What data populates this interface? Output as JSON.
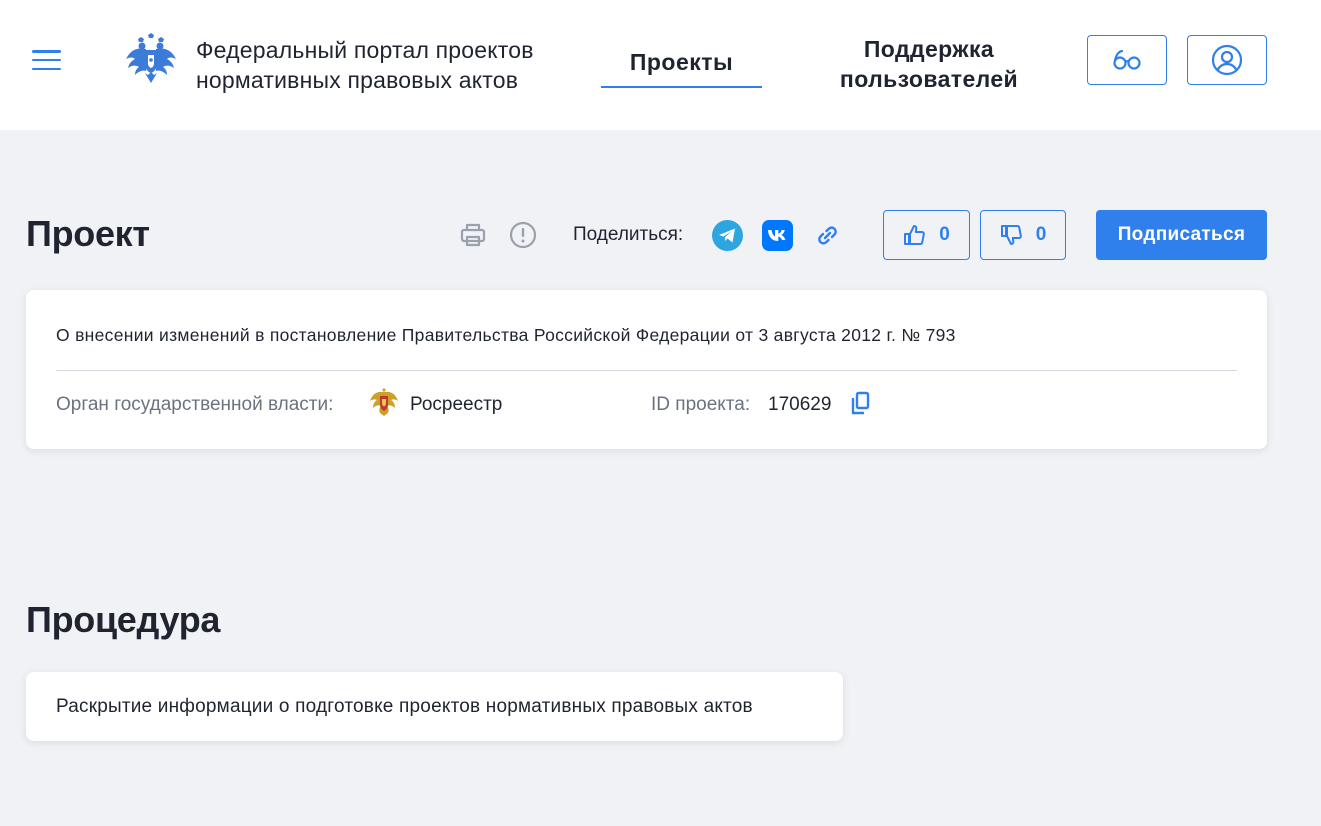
{
  "header": {
    "portal_title_line1": "Федеральный портал проектов",
    "portal_title_line2": "нормативных правовых актов",
    "nav": {
      "projects": "Проекты",
      "support_line1": "Поддержка",
      "support_line2": "пользователей"
    },
    "icons": [
      "menu-icon",
      "coat-of-arms-emblem",
      "glasses-icon",
      "user-account-icon"
    ]
  },
  "project_section": {
    "heading": "Проект",
    "share_label": "Поделиться:",
    "likes": "0",
    "dislikes": "0",
    "subscribe_label": "Подписаться",
    "icons": [
      "print-icon",
      "report-icon",
      "telegram-icon",
      "vk-icon",
      "link-icon",
      "thumbs-up-icon",
      "thumbs-down-icon"
    ]
  },
  "project_card": {
    "title": "О внесении изменений в постановление Правительства Российской Федерации от 3 августа 2012 г. № 793",
    "org_label": "Орган государственной власти:",
    "org_name": "Росреестр",
    "id_label": "ID проекта:",
    "id_value": "170629"
  },
  "procedure_section": {
    "heading": "Процедура",
    "text": "Раскрытие информации о подготовке проектов нормативных правовых актов"
  },
  "colors": {
    "accent": "#2f80ed",
    "background": "#f0f2f5",
    "text": "#1f2430",
    "muted": "#6b7280",
    "telegram": "#2ca5e0",
    "vk": "#0077ff"
  }
}
